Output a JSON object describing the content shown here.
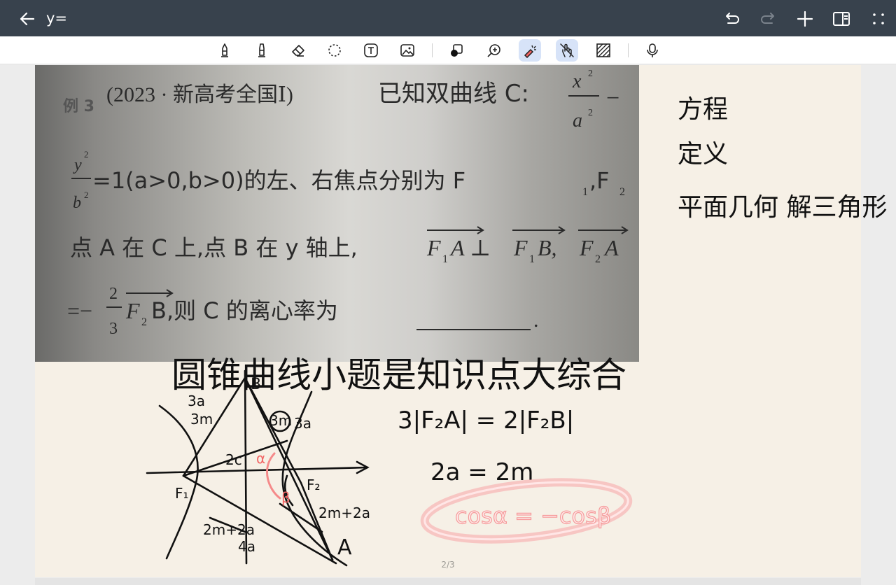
{
  "app": {
    "title": "y=",
    "page_indicator": "2/3"
  },
  "titlebar_icons": [
    "back-arrow-icon",
    "undo-icon",
    "redo-icon",
    "add-icon",
    "panel-icon",
    "more-icon"
  ],
  "toolbar": {
    "tools": [
      "pen-icon",
      "highlighter-icon",
      "eraser-icon",
      "lasso-icon",
      "text-icon",
      "image-icon",
      "shape-icon",
      "zoom-icon",
      "laser-pointer-icon",
      "touch-draw-icon",
      "pattern-icon",
      "microphone-icon"
    ],
    "active_tools": [
      "laser-pointer-icon",
      "touch-draw-icon"
    ],
    "active_color": "#d7e3f8"
  },
  "problem": {
    "label": "例 3",
    "source": "(2023 · 新高考全国Ⅰ)",
    "line1": "已知双曲线 C:",
    "line2": "=1(a>0,b>0)的左、右焦点分别为 F",
    "line2b": ",F",
    "line3a": "点 A 在 C 上,点 B 在 y 轴上,",
    "line3b": "F",
    "line3c": "A ⊥ ",
    "line3d": "B,",
    "line4": "B,则 C 的离心率为",
    "x2": "x",
    "a2": "a",
    "y2": "y",
    "b2": "b",
    "sup2": "2",
    "frac_num": "2",
    "frac_den": "3",
    "eq_prefix": "=−",
    "minus": "−",
    "sub1": "1",
    "sub2": "2",
    "F": "F",
    "A": "A",
    "blank_dot": "."
  },
  "notes": {
    "heading": "圆锥曲线小题是知识点大综合",
    "side1": "方程",
    "side2": "定义",
    "side3": "平面几何 解三角形",
    "eq1": "3|F₂A| = 2|F₂B|",
    "eq2": "2a = 2m",
    "eq3": "cosα = −cosβ",
    "diagram_labels": [
      "3a",
      "3m",
      "3m",
      "3a",
      "2c",
      "α",
      "β",
      "F₁",
      "F₂",
      "2m+2a",
      "2m+2a",
      "4a",
      "A",
      "B"
    ]
  },
  "colors": {
    "titlebar": "#38424d",
    "ink": "#111111",
    "highlight_ink": "#f26464"
  }
}
